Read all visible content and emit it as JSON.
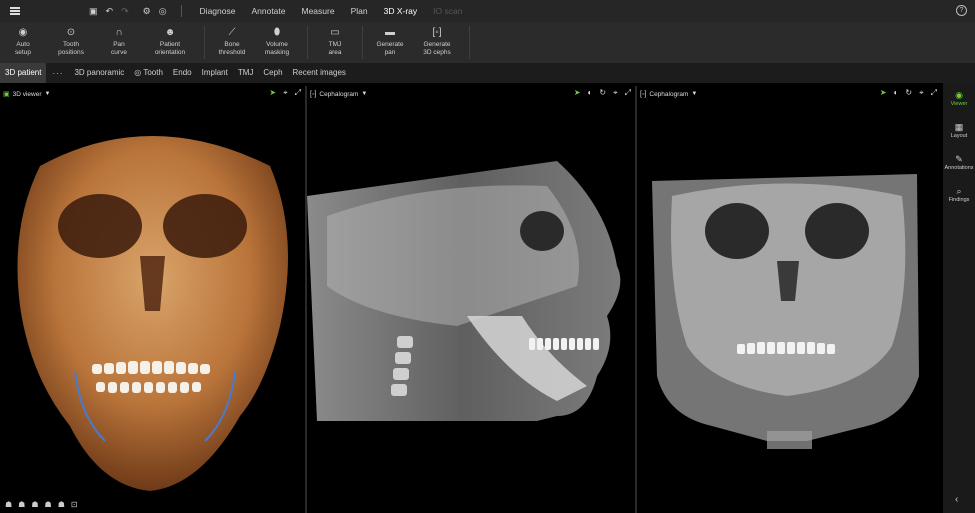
{
  "menubar": {
    "items": [
      {
        "label": "Diagnose",
        "state": "normal"
      },
      {
        "label": "Annotate",
        "state": "normal"
      },
      {
        "label": "Measure",
        "state": "normal"
      },
      {
        "label": "Plan",
        "state": "normal"
      },
      {
        "label": "3D X-ray",
        "state": "active"
      },
      {
        "label": "IO scan",
        "state": "disabled"
      }
    ],
    "quick_icons": [
      "save-icon",
      "undo-icon",
      "redo-icon",
      "tools-icon",
      "settings-icon"
    ],
    "help": "?"
  },
  "ribbon": {
    "tools": [
      {
        "icon": "auto-setup-icon",
        "glyph": "◉",
        "line1": "Auto",
        "line2": "setup"
      },
      {
        "icon": "tooth-positions-icon",
        "glyph": "⊙",
        "line1": "Tooth",
        "line2": "positions"
      },
      {
        "icon": "pan-curve-icon",
        "glyph": "∩",
        "line1": "Pan",
        "line2": "curve"
      },
      {
        "icon": "patient-orientation-icon",
        "glyph": "☻",
        "line1": "Patient",
        "line2": "orientation"
      },
      {
        "icon": "bone-threshold-icon",
        "glyph": "⟋",
        "line1": "Bone",
        "line2": "threshold"
      },
      {
        "icon": "volume-masking-icon",
        "glyph": "⬮",
        "line1": "Volume",
        "line2": "masking"
      },
      {
        "icon": "tmj-area-icon",
        "glyph": "▭",
        "line1": "TMJ",
        "line2": "area"
      },
      {
        "icon": "generate-pan-icon",
        "glyph": "▬",
        "line1": "Generate",
        "line2": "pan"
      },
      {
        "icon": "generate-3d-cephs-icon",
        "glyph": "[◦]",
        "line1": "Generate",
        "line2": "3D cephs"
      }
    ]
  },
  "tabs": {
    "items": [
      "3D patient",
      "3D panoramic",
      "Tooth",
      "Endo",
      "Implant",
      "TMJ",
      "Ceph",
      "Recent images"
    ],
    "active": "3D patient",
    "more": "···"
  },
  "panes": {
    "p1": {
      "title": "3D viewer"
    },
    "p2": {
      "title": "Cephalogram"
    },
    "p3": {
      "title": "Cephalogram"
    }
  },
  "rail": {
    "items": [
      {
        "label": "Viewer",
        "icon": "eye-icon",
        "glyph": "◉",
        "active": true
      },
      {
        "label": "Layout",
        "icon": "layout-icon",
        "glyph": "▦",
        "active": false
      },
      {
        "label": "Annotations",
        "icon": "pen-icon",
        "glyph": "✎",
        "active": false
      },
      {
        "label": "Findings",
        "icon": "findings-icon",
        "glyph": "⌕",
        "active": false
      }
    ],
    "collapse": "‹"
  },
  "colors": {
    "accent": "#6fcf3a",
    "bone_3d": "#c9894a",
    "xray": "#d8d8d8"
  }
}
